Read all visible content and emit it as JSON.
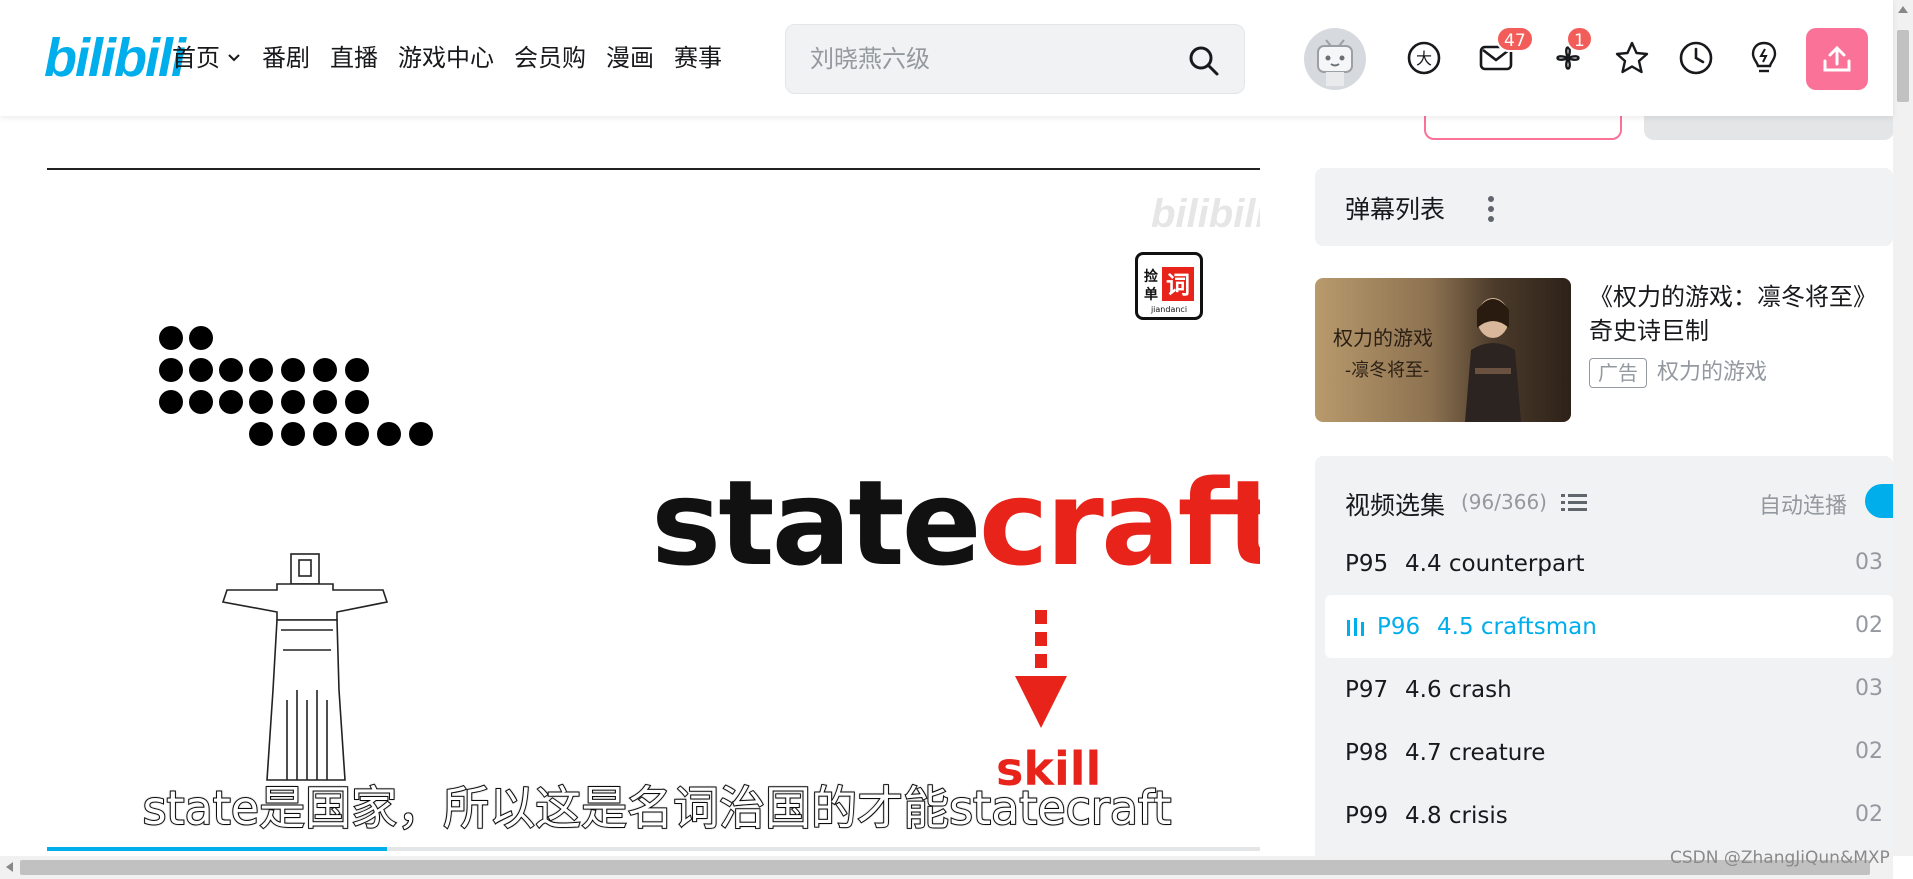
{
  "header": {
    "logo": "bilibili",
    "nav": [
      {
        "label": "首页",
        "has_dropdown": true
      },
      {
        "label": "番剧"
      },
      {
        "label": "直播"
      },
      {
        "label": "游戏中心"
      },
      {
        "label": "会员购"
      },
      {
        "label": "漫画"
      },
      {
        "label": "赛事"
      }
    ],
    "search_placeholder": "刘晓燕六级",
    "messages_badge": "47",
    "dynamics_badge": "1",
    "icons": [
      "big-vip-icon",
      "message-icon",
      "dynamic-icon",
      "favorite-icon",
      "history-icon",
      "creative-icon",
      "upload-icon"
    ]
  },
  "video": {
    "watermark": "bilibili",
    "channel_logo_text": "捡单词",
    "word_black": "state",
    "word_red": "craft",
    "arrow_label": "skill",
    "subtitle": "state是国家，所以这是名词治国的才能statecraft",
    "progress": 0.28
  },
  "danmaku": {
    "title": "弹幕列表"
  },
  "ad": {
    "thumb_title": "权力的游戏",
    "thumb_subtitle": "-凛冬将至-",
    "title": "《权力的游戏：凛冬将至》奇史诗巨制",
    "tag": "广告",
    "source": "权力的游戏"
  },
  "episodes": {
    "title": "视频选集",
    "count": "(96/366)",
    "autoplay_label": "自动连播",
    "autoplay_on": true,
    "items": [
      {
        "no": "P95",
        "title": "4.4 counterpart",
        "duration": "03",
        "active": false
      },
      {
        "no": "P96",
        "title": "4.5 craftsman",
        "duration": "02",
        "active": true
      },
      {
        "no": "P97",
        "title": "4.6 crash",
        "duration": "03",
        "active": false
      },
      {
        "no": "P98",
        "title": "4.7 creature",
        "duration": "02",
        "active": false
      },
      {
        "no": "P99",
        "title": "4.8 crisis",
        "duration": "02",
        "active": false
      }
    ]
  },
  "watermark": "CSDN @ZhangJiQun&MXP",
  "colors": {
    "brand_blue": "#00aeec",
    "brand_pink": "#fb7299",
    "badge_red": "#f25d59",
    "craft_red": "#e8231a"
  }
}
